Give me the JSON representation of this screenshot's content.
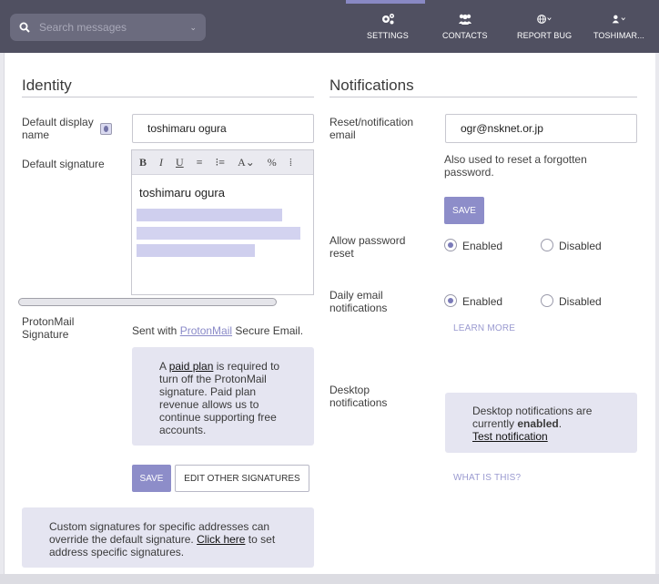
{
  "topbar": {
    "search_placeholder": "Search messages",
    "nav": [
      {
        "label": "SETTINGS",
        "icon": "gears-icon"
      },
      {
        "label": "CONTACTS",
        "icon": "contacts-icon"
      },
      {
        "label": "REPORT BUG",
        "icon": "globe-icon"
      },
      {
        "label": "TOSHIMAR...",
        "icon": "user-icon"
      }
    ]
  },
  "identity": {
    "title": "Identity",
    "display_name_label": "Default display name",
    "display_name_value": "toshimaru ogura",
    "signature_label": "Default signature",
    "toolbar": [
      "B",
      "I",
      "U",
      "≡",
      "⁝≡",
      "A⌄",
      "%",
      "⁞"
    ],
    "signature_text": "toshimaru ogura",
    "pm_signature_label": "ProtonMail Signature",
    "pm_sent_prefix": "Sent with ",
    "pm_link": "ProtonMail",
    "pm_sent_suffix": " Secure Email.",
    "paid_box": {
      "prefix": "A ",
      "link": "paid plan",
      "suffix": " is required to turn off the ProtonMail signature. Paid plan revenue allows us to continue supporting free accounts."
    },
    "save_label": "SAVE",
    "edit_other_label": "EDIT OTHER SIGNATURES",
    "custom_box": {
      "prefix": "Custom signatures for specific addresses can override the default signature. ",
      "link": "Click here",
      "suffix": " to set address specific signatures."
    }
  },
  "notifications": {
    "title": "Notifications",
    "email_label": "Reset/notification email",
    "email_value": "ogr@nsknet.or.jp",
    "email_help": "Also used to reset a forgotten password.",
    "save_label": "SAVE",
    "allow_reset_label": "Allow password reset",
    "daily_label": "Daily email notifications",
    "enabled_label": "Enabled",
    "disabled_label": "Disabled",
    "learn_more": "LEARN MORE",
    "desktop_label": "Desktop notifications",
    "desktop_box": {
      "prefix": "Desktop notifications are currently ",
      "status": "enabled",
      "suffix": ".",
      "link": "Test notification"
    },
    "what_is_this": "WHAT IS THIS?"
  }
}
